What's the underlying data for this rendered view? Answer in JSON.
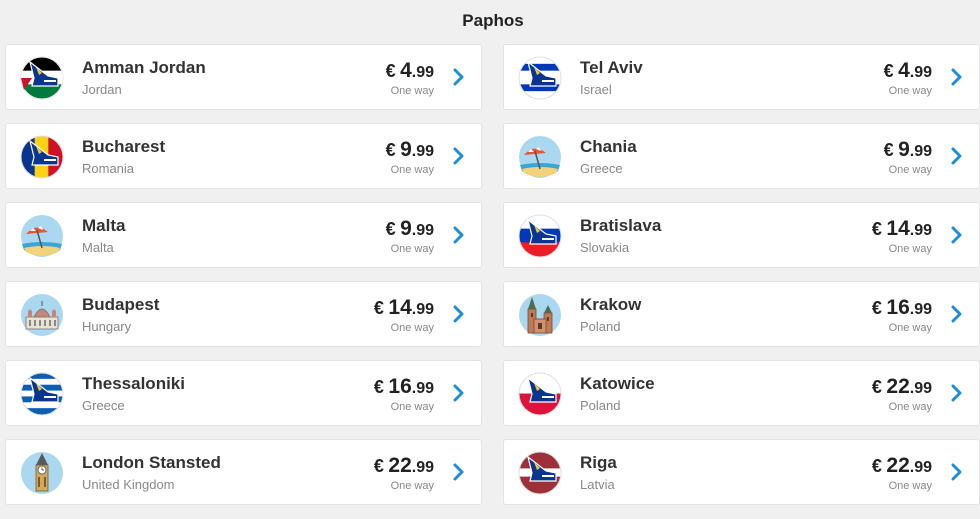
{
  "page": {
    "title": "Paphos"
  },
  "destinations": [
    {
      "city": "Amman Jordan",
      "country": "Jordan",
      "currency": "€",
      "price_int": "4",
      "price_dec": ".99",
      "trip_type": "One way",
      "icon": "plane-jordan-flag-icon"
    },
    {
      "city": "Tel Aviv",
      "country": "Israel",
      "currency": "€",
      "price_int": "4",
      "price_dec": ".99",
      "trip_type": "One way",
      "icon": "plane-israel-flag-icon"
    },
    {
      "city": "Bucharest",
      "country": "Romania",
      "currency": "€",
      "price_int": "9",
      "price_dec": ".99",
      "trip_type": "One way",
      "icon": "plane-romania-flag-icon"
    },
    {
      "city": "Chania",
      "country": "Greece",
      "currency": "€",
      "price_int": "9",
      "price_dec": ".99",
      "trip_type": "One way",
      "icon": "beach-umbrella-icon"
    },
    {
      "city": "Malta",
      "country": "Malta",
      "currency": "€",
      "price_int": "9",
      "price_dec": ".99",
      "trip_type": "One way",
      "icon": "beach-umbrella-icon"
    },
    {
      "city": "Bratislava",
      "country": "Slovakia",
      "currency": "€",
      "price_int": "14",
      "price_dec": ".99",
      "trip_type": "One way",
      "icon": "plane-slovakia-flag-icon"
    },
    {
      "city": "Budapest",
      "country": "Hungary",
      "currency": "€",
      "price_int": "14",
      "price_dec": ".99",
      "trip_type": "One way",
      "icon": "parliament-building-icon"
    },
    {
      "city": "Krakow",
      "country": "Poland",
      "currency": "€",
      "price_int": "16",
      "price_dec": ".99",
      "trip_type": "One way",
      "icon": "church-towers-icon"
    },
    {
      "city": "Thessaloniki",
      "country": "Greece",
      "currency": "€",
      "price_int": "16",
      "price_dec": ".99",
      "trip_type": "One way",
      "icon": "plane-greece-flag-icon"
    },
    {
      "city": "Katowice",
      "country": "Poland",
      "currency": "€",
      "price_int": "22",
      "price_dec": ".99",
      "trip_type": "One way",
      "icon": "plane-poland-flag-icon"
    },
    {
      "city": "London Stansted",
      "country": "United Kingdom",
      "currency": "€",
      "price_int": "22",
      "price_dec": ".99",
      "trip_type": "One way",
      "icon": "big-ben-icon"
    },
    {
      "city": "Riga",
      "country": "Latvia",
      "currency": "€",
      "price_int": "22",
      "price_dec": ".99",
      "trip_type": "One way",
      "icon": "plane-latvia-flag-icon"
    }
  ],
  "colors": {
    "ryanair_navy": "#073590",
    "ryanair_yellow": "#f1c933",
    "chevron_blue": "#1a8fdc",
    "jordan_red": "#ce1126",
    "jordan_green": "#007a3d",
    "israel_blue": "#0038b8",
    "romania_yellow": "#fcd116",
    "romania_red": "#ce1126",
    "slovakia_red": "#ee1c25",
    "greece_blue": "#0d5eaf",
    "poland_red": "#dc143c",
    "latvia_maroon": "#9e3039",
    "sky_blue": "#aad8f0"
  }
}
